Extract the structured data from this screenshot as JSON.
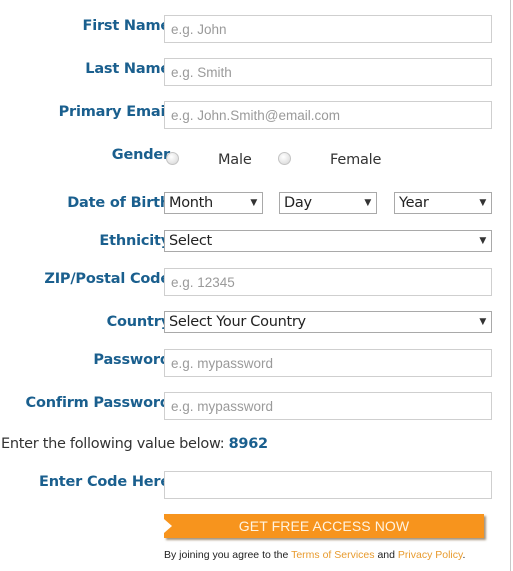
{
  "form": {
    "first_name": {
      "label": "First Name",
      "placeholder": "e.g. John",
      "value": ""
    },
    "last_name": {
      "label": "Last Name",
      "placeholder": "e.g. Smith",
      "value": ""
    },
    "email": {
      "label": "Primary Email",
      "placeholder": "e.g. John.Smith@email.com",
      "value": ""
    },
    "gender": {
      "label": "Gender",
      "options": [
        "Male",
        "Female"
      ],
      "selected": null
    },
    "dob": {
      "label": "Date of Birth",
      "month": "Month",
      "day": "Day",
      "year": "Year"
    },
    "ethnicity": {
      "label": "Ethnicity",
      "selected": "Select"
    },
    "zip": {
      "label": "ZIP/Postal Code",
      "placeholder": "e.g. 12345",
      "value": ""
    },
    "country": {
      "label": "Country",
      "selected": "Select Your Country"
    },
    "password": {
      "label": "Password",
      "placeholder": "e.g. mypassword",
      "value": ""
    },
    "confirm_password": {
      "label": "Confirm Password",
      "placeholder": "e.g. mypassword",
      "value": ""
    },
    "captcha": {
      "prompt": "Enter the following value below:",
      "code": "8962",
      "label": "Enter Code Here",
      "value": ""
    },
    "submit_label": "GET FREE ACCESS NOW",
    "legal": {
      "prefix": "By joining you agree to the",
      "terms": "Terms of Services",
      "and": "and",
      "privacy": "Privacy Policy",
      "suffix": "."
    }
  },
  "colors": {
    "label": "#1a5f8e",
    "accent": "#f7941d",
    "link": "#e89b2e"
  },
  "icons": {
    "select_arrow": "▼"
  }
}
